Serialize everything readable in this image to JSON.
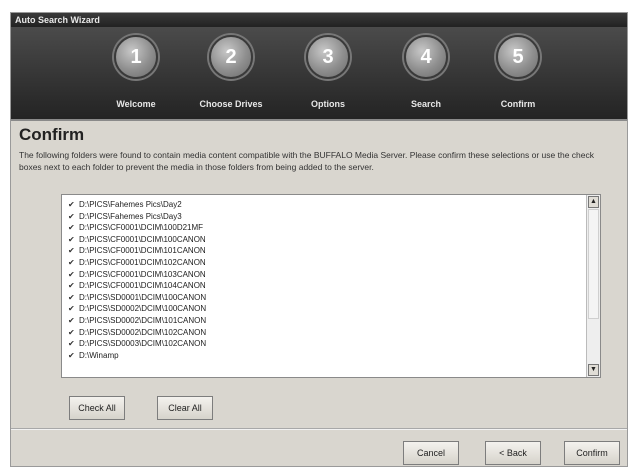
{
  "window": {
    "title": "Auto Search Wizard"
  },
  "steps": [
    {
      "number": "1",
      "label": "Welcome"
    },
    {
      "number": "2",
      "label": "Choose Drives"
    },
    {
      "number": "3",
      "label": "Options"
    },
    {
      "number": "4",
      "label": "Search"
    },
    {
      "number": "5",
      "label": "Confirm"
    }
  ],
  "page": {
    "heading": "Confirm",
    "description": "The following folders were found to contain media content compatible with the BUFFALO Media Server. Please confirm these selections or use the check boxes next to each folder to prevent the media in those folders from being added to the server."
  },
  "folders": [
    {
      "path": "D:\\PICS\\Fahemes Pics\\Day2",
      "checked": true
    },
    {
      "path": "D:\\PICS\\Fahemes Pics\\Day3",
      "checked": true
    },
    {
      "path": "D:\\PICS\\CF0001\\DCIM\\100D21MF",
      "checked": true
    },
    {
      "path": "D:\\PICS\\CF0001\\DCIM\\100CANON",
      "checked": true
    },
    {
      "path": "D:\\PICS\\CF0001\\DCIM\\101CANON",
      "checked": true
    },
    {
      "path": "D:\\PICS\\CF0001\\DCIM\\102CANON",
      "checked": true
    },
    {
      "path": "D:\\PICS\\CF0001\\DCIM\\103CANON",
      "checked": true
    },
    {
      "path": "D:\\PICS\\CF0001\\DCIM\\104CANON",
      "checked": true
    },
    {
      "path": "D:\\PICS\\SD0001\\DCIM\\100CANON",
      "checked": true
    },
    {
      "path": "D:\\PICS\\SD0002\\DCIM\\100CANON",
      "checked": true
    },
    {
      "path": "D:\\PICS\\SD0002\\DCIM\\101CANON",
      "checked": true
    },
    {
      "path": "D:\\PICS\\SD0002\\DCIM\\102CANON",
      "checked": true
    },
    {
      "path": "D:\\PICS\\SD0003\\DCIM\\102CANON",
      "checked": true
    },
    {
      "path": "D:\\Winamp",
      "checked": true
    }
  ],
  "buttons": {
    "check_all": "Check All",
    "clear_all": "Clear All",
    "cancel": "Cancel",
    "back": "< Back",
    "confirm": "Confirm"
  },
  "scrollbar": {
    "up_glyph": "▲",
    "down_glyph": "▼"
  },
  "check_glyph": "✔",
  "colors": {
    "banner": "#2b2b2b",
    "dialog_bg": "#d9d6cf",
    "step_circle": "#8e8e8e"
  }
}
